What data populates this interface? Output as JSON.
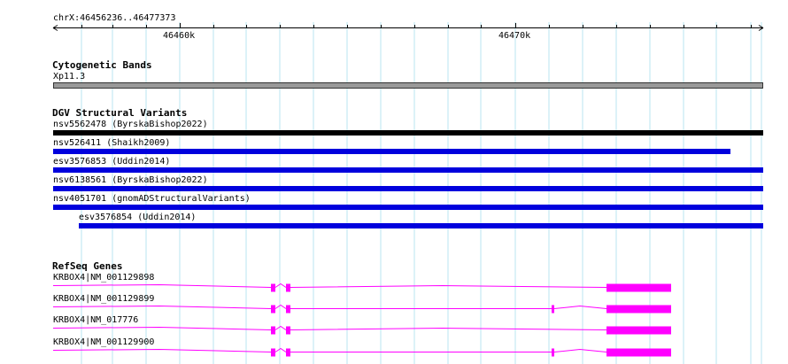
{
  "ruler": {
    "range_label": "chrX:46456236..46477373",
    "ticks": [
      {
        "label": "46460k",
        "pos": 46460000
      },
      {
        "label": "46470k",
        "pos": 46470000
      }
    ],
    "start": 46456236,
    "end": 46477373
  },
  "tracks": {
    "cytoband": {
      "title": "Cytogenetic Bands",
      "band_label": "Xp11.3",
      "color": "#999999"
    },
    "dgv": {
      "title": "DGV Structural Variants",
      "features": [
        {
          "label": "nsv5562478 (ByrskaBishop2022)",
          "color": "#000000",
          "start": 46456236,
          "end": 46477373
        },
        {
          "label": "nsv526411 (Shaikh2009)",
          "color": "#0000dd",
          "start": 46456236,
          "end": 46476400
        },
        {
          "label": "esv3576853 (Uddin2014)",
          "color": "#0000dd",
          "start": 46456236,
          "end": 46477373
        },
        {
          "label": "nsv6138561 (ByrskaBishop2022)",
          "color": "#0000dd",
          "start": 46456236,
          "end": 46477373
        },
        {
          "label": "nsv4051701 (gnomADStructuralVariants)",
          "color": "#0000dd",
          "start": 46456236,
          "end": 46477373
        },
        {
          "label": "esv3576854 (Uddin2014)",
          "color": "#0000dd",
          "start": 46457000,
          "end": 46477373
        }
      ]
    },
    "refseq": {
      "title": "RefSeq Genes",
      "color": "#ff00ff",
      "genes": [
        {
          "label": "KRBOX4|NM_001129898",
          "has_mid_exon": false
        },
        {
          "label": "KRBOX4|NM_001129899",
          "has_mid_exon": true
        },
        {
          "label": "KRBOX4|NM_017776",
          "has_mid_exon": false
        },
        {
          "label": "KRBOX4|NM_001129900",
          "has_mid_exon": true
        }
      ]
    }
  }
}
